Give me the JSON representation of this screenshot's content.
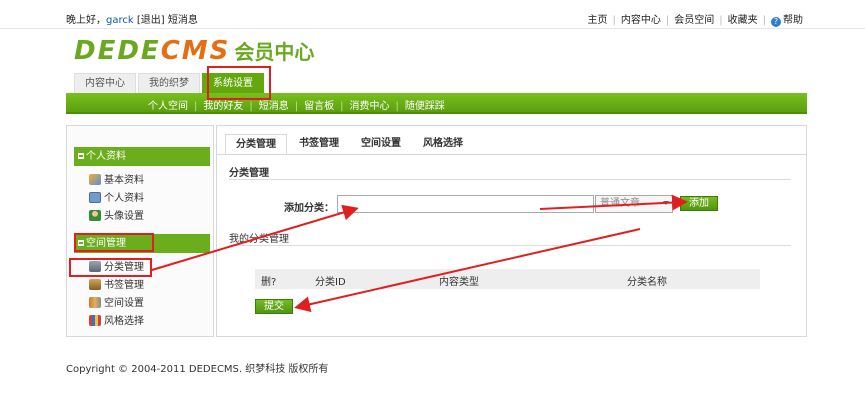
{
  "top": {
    "greeting": "晚上好，",
    "username": "garck",
    "logout": "[退出]",
    "messages": "短消息",
    "links": [
      "主页",
      "内容中心",
      "会员空间",
      "收藏夹",
      "帮助"
    ]
  },
  "logo": {
    "dede": "DEDE",
    "cms": "CMS",
    "sub": "会员中心"
  },
  "main_tabs": [
    "内容中心",
    "我的织梦",
    "系统设置"
  ],
  "sub_nav": [
    "个人空间",
    "我的好友",
    "短消息",
    "留言板",
    "消费中心",
    "随便踩踩"
  ],
  "sidebar": {
    "group1": "个人资料",
    "group1_items": [
      "基本资料",
      "个人资料",
      "头像设置"
    ],
    "group2": "空间管理",
    "group2_items": [
      "分类管理",
      "书签管理",
      "空间设置",
      "风格选择"
    ]
  },
  "content": {
    "tabs": [
      "分类管理",
      "书签管理",
      "空间设置",
      "风格选择"
    ],
    "section_title": "分类管理",
    "add_label": "添加分类：",
    "add_input_value": "",
    "select_value": "普通文章",
    "add_button": "添加",
    "my_categories": "我的分类管理",
    "table_headers": [
      "删?",
      "分类ID",
      "内容类型",
      "分类名称"
    ],
    "submit_button": "提交"
  },
  "footer": "Copyright © 2004-2011 DEDECMS. 织梦科技 版权所有",
  "colors": {
    "brand_green": "#6aae1e",
    "annotation_red": "#e02020",
    "logo_orange": "#e46e12"
  }
}
